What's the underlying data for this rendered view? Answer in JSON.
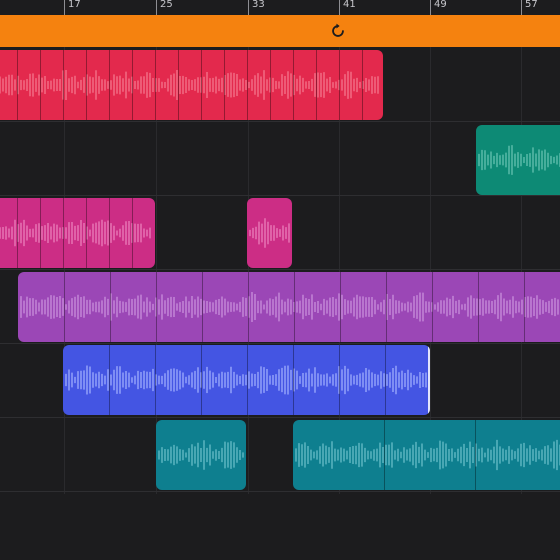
{
  "ruler": {
    "bar_labels": [
      "17",
      "25",
      "33",
      "41",
      "49",
      "57"
    ]
  },
  "cycle": {
    "icon": "loop-icon",
    "color": "#f5820f"
  },
  "tracks": [
    {
      "color": "#e3294d",
      "wave": "#f57d91"
    },
    {
      "color": "#0d8a75",
      "wave": "#6cc7b5"
    },
    {
      "color": "#cc2d85",
      "wave": "#ee86bf"
    },
    {
      "color": "#9b47b6",
      "wave": "#cd96df"
    },
    {
      "color": "#4455e3",
      "wave": "#a6b3ff"
    },
    {
      "color": "#0e7f8f",
      "wave": "#6fc2ce"
    }
  ]
}
